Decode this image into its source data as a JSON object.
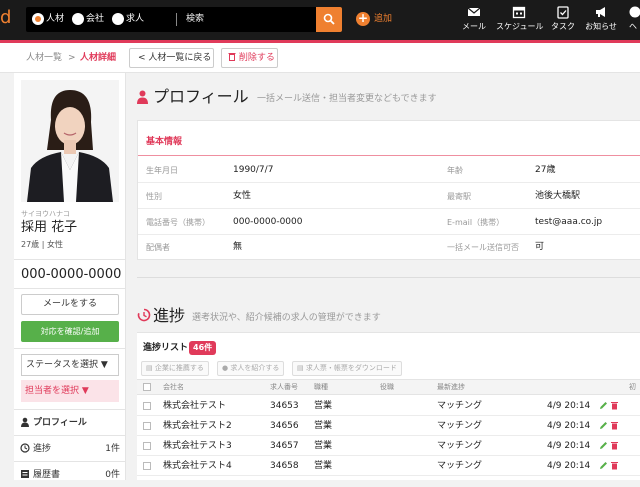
{
  "brand": {
    "glyph": "d",
    "color": "#ef8030"
  },
  "search": {
    "options": [
      {
        "label": "人材",
        "selected": true
      },
      {
        "label": "会社",
        "selected": false
      },
      {
        "label": "求人",
        "selected": false
      }
    ],
    "placeholder": "検索",
    "button_icon": "search-icon"
  },
  "add": {
    "label": "追加"
  },
  "nav": [
    {
      "label": "メール",
      "icon": "mail-icon"
    },
    {
      "label": "スケジュール",
      "icon": "calendar-icon"
    },
    {
      "label": "タスク",
      "icon": "task-icon"
    },
    {
      "label": "お知らせ",
      "icon": "megaphone-icon"
    },
    {
      "label": "ヘ",
      "icon": "help-icon"
    }
  ],
  "breadcrumb": {
    "parent": "人材一覧",
    "separator": ">",
    "current": "人材詳細"
  },
  "actions": {
    "back": "<  人材一覧に戻る",
    "delete": "削除する"
  },
  "person": {
    "kana": "サイヨウハナコ",
    "name": "採用 花子",
    "age_gender": "27歳 | 女性",
    "phone": "000-0000-0000"
  },
  "left_actions": {
    "mail": "メールをする",
    "confirm": "対応を確認/追加",
    "status_select": "ステータスを選択 ▼",
    "owner_select": "担当者を選択 ▼"
  },
  "side_menu": [
    {
      "label": "プロフィール",
      "count": "",
      "icon": "person-icon"
    },
    {
      "label": "進捗",
      "count": "1件",
      "icon": "progress-icon"
    },
    {
      "label": "履歴書",
      "count": "0件",
      "icon": "document-icon"
    }
  ],
  "profile": {
    "title": "プロフィール",
    "subtitle": "一括メール送信・担当者変更などもできます",
    "card_title": "基本情報",
    "fields": [
      {
        "label": "生年月日",
        "value": "1990/7/7"
      },
      {
        "label": "年齢",
        "value": "27歳"
      },
      {
        "label": "性別",
        "value": "女性"
      },
      {
        "label": "最寄駅",
        "value": "池後大橋駅"
      },
      {
        "label": "電話番号（携帯）",
        "value": "000-0000-0000"
      },
      {
        "label": "E-mail（携帯）",
        "value": "test@aaa.co.jp"
      },
      {
        "label": "配偶者",
        "value": "無"
      },
      {
        "label": "一括メール送信可否",
        "value": "可"
      }
    ]
  },
  "progress": {
    "title": "進捗",
    "subtitle": "選考状況や、紹介候補の求人の管理ができます",
    "list_title": "進捗リスト",
    "count": "46件",
    "buttons": [
      "企業に推薦する",
      "求人を紹介する",
      "求人票・帳票をダウンロード"
    ],
    "columns": [
      "会社名",
      "求人番号",
      "職種",
      "役職",
      "最新進捗",
      "初"
    ],
    "rows": [
      {
        "company": "株式会社テスト",
        "job_no": "34653",
        "job_type": "営業",
        "position": "",
        "status": "マッチング",
        "date": "4/9 20:14"
      },
      {
        "company": "株式会社テスト2",
        "job_no": "34656",
        "job_type": "営業",
        "position": "",
        "status": "マッチング",
        "date": "4/9 20:14"
      },
      {
        "company": "株式会社テスト3",
        "job_no": "34657",
        "job_type": "営業",
        "position": "",
        "status": "マッチング",
        "date": "4/9 20:14"
      },
      {
        "company": "株式会社テスト4",
        "job_no": "34658",
        "job_type": "営業",
        "position": "",
        "status": "マッチング",
        "date": "4/9 20:14"
      }
    ]
  },
  "colors": {
    "accent": "#e03a5a",
    "orange": "#ef8030",
    "green": "#57b04a",
    "topbar": "#1a1a1a"
  }
}
